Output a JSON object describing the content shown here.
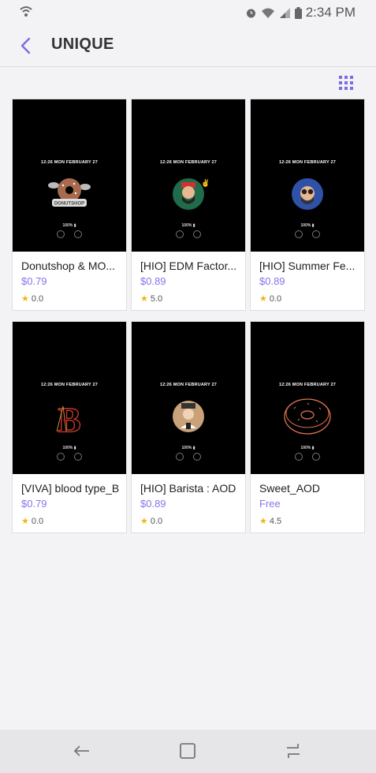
{
  "status_bar": {
    "time": "2:34 PM",
    "icons": [
      "data-sync-icon",
      "alarm-icon",
      "wifi-icon",
      "signal-icon",
      "battery-icon"
    ]
  },
  "header": {
    "title": "UNIQUE",
    "back_icon": "back-arrow-icon",
    "view_toggle_icon": "grid-view-icon"
  },
  "items": [
    {
      "name": "Donutshop & MO...",
      "price": "$0.79",
      "rating": "0.0",
      "clock": "12:26  MON FEBRUARY 27",
      "battery": "100% ▮",
      "art_label": "DONUTSHOP"
    },
    {
      "name": "[HIO] EDM Factor...",
      "price": "$0.89",
      "rating": "5.0",
      "clock": "12:26  MON FEBRUARY 27",
      "battery": "100% ▮"
    },
    {
      "name": "[HIO] Summer Fe...",
      "price": "$0.89",
      "rating": "0.0",
      "clock": "12:26  MON FEBRUARY 27",
      "battery": "100% ▮"
    },
    {
      "name": "[VIVA] blood type_B",
      "price": "$0.79",
      "rating": "0.0",
      "clock": "12:26  MON FEBRUARY 27",
      "battery": "100% ▮"
    },
    {
      "name": "[HIO] Barista : AOD",
      "price": "$0.89",
      "rating": "0.0",
      "clock": "12:26  MON FEBRUARY 27",
      "battery": "100% ▮"
    },
    {
      "name": "Sweet_AOD",
      "price": "Free",
      "rating": "4.5",
      "clock": "12:26  MON FEBRUARY 27",
      "battery": "100% ▮"
    }
  ],
  "nav_bar": {
    "icons": [
      "back-nav-icon",
      "home-nav-icon",
      "recents-nav-icon"
    ]
  },
  "colors": {
    "accent": "#8a72e8",
    "star": "#f2b416",
    "background": "#f3f3f5"
  }
}
